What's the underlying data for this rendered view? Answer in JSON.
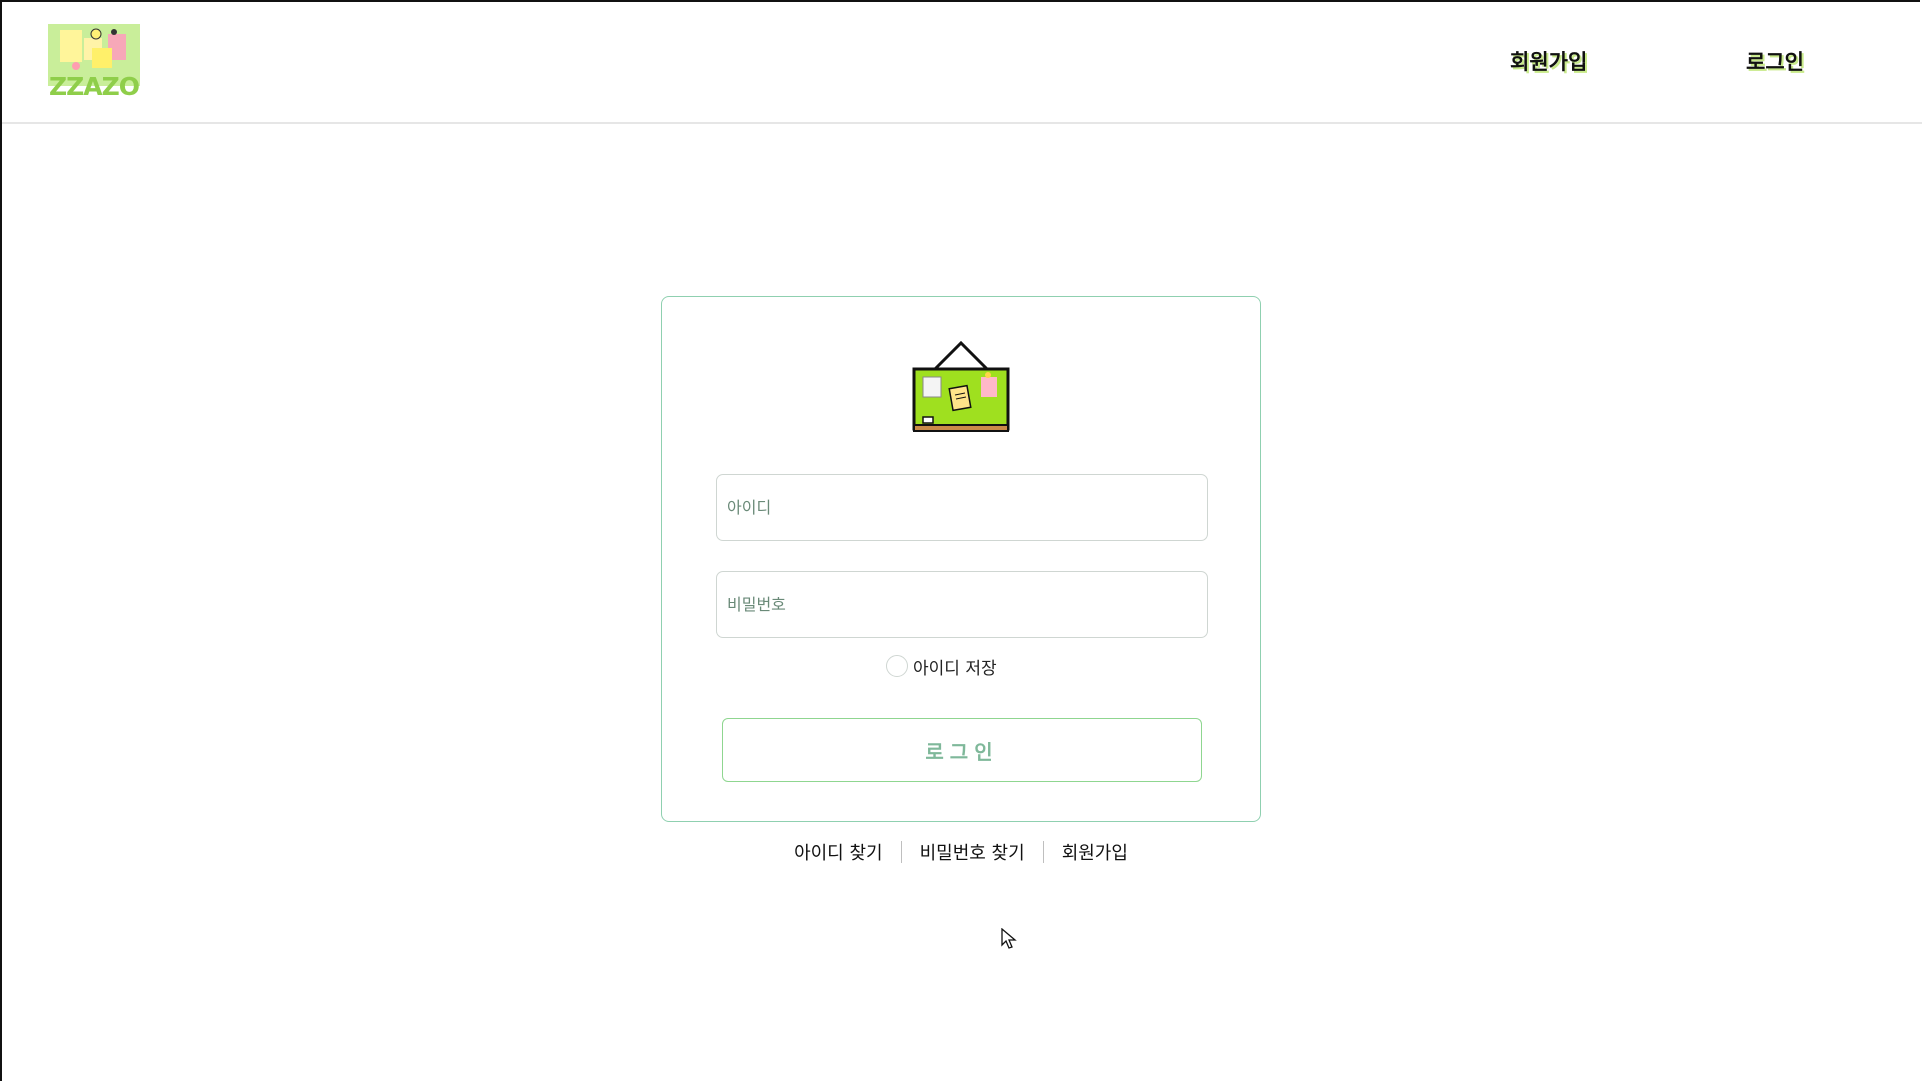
{
  "header": {
    "logo_text": "ZZAZO",
    "nav": {
      "signup_label": "회원가입",
      "login_label": "로그인"
    }
  },
  "login_form": {
    "id_placeholder": "아이디",
    "password_placeholder": "비밀번호",
    "remember_label": "아이디 저장",
    "submit_label": "로그인"
  },
  "footer_links": {
    "find_id": "아이디 찾기",
    "find_password": "비밀번호 찾기",
    "signup": "회원가입"
  },
  "colors": {
    "accent_green": "#8fce4a",
    "card_border": "#8fd0b0",
    "button_text": "#7fb89a"
  },
  "icons": {
    "logo": "corkboard-notes-logo",
    "board": "hanging-bulletin-board-icon",
    "cursor": "mouse-pointer-icon"
  }
}
